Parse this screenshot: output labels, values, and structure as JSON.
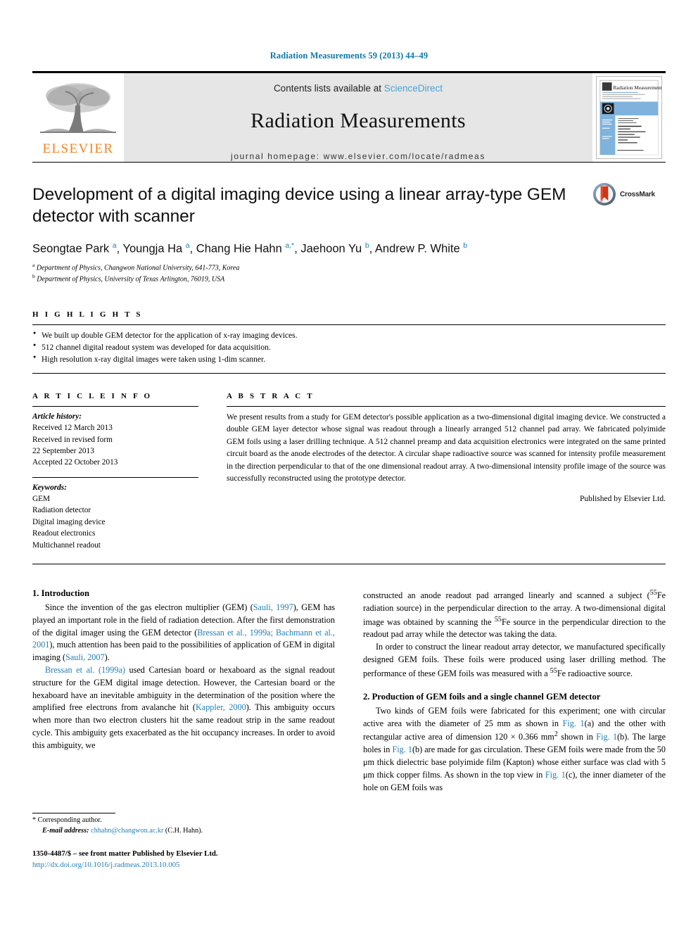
{
  "running_head": "Radiation Measurements 59 (2013) 44–49",
  "masthead": {
    "publisher_name": "ELSEVIER",
    "contents_prefix": "Contents lists available at ",
    "contents_link": "ScienceDirect",
    "journal_title": "Radiation Measurements",
    "homepage": "journal homepage: www.elsevier.com/locate/radmeas",
    "cover_title": "Radiation Measurements"
  },
  "article": {
    "title": "Development of a digital imaging device using a linear array-type GEM detector with scanner",
    "authors_html": "Seongtae Park <sup>a</sup>, Youngja Ha <sup>a</sup>, Chang Hie Hahn <sup>a,*</sup>, Jaehoon Yu <sup>b</sup>, Andrew P. White <sup>b</sup>",
    "affiliation_a": "Department of Physics, Changwon National University, 641-773, Korea",
    "affiliation_b": "Department of Physics, University of Texas Arlington, 76019, USA",
    "crossmark_label": "CrossMark"
  },
  "highlights": {
    "label": "H I G H L I G H T S",
    "items": [
      "We built up double GEM detector for the application of x-ray imaging devices.",
      "512 channel digital readout system was developed for data acquisition.",
      "High resolution x-ray digital images were taken using 1-dim scanner."
    ]
  },
  "article_info": {
    "label": "A R T I C L E   I N F O",
    "history_label": "Article history:",
    "history": [
      "Received 12 March 2013",
      "Received in revised form",
      "22 September 2013",
      "Accepted 22 October 2013"
    ],
    "keywords_label": "Keywords:",
    "keywords": [
      "GEM",
      "Radiation detector",
      "Digital imaging device",
      "Readout electronics",
      "Multichannel readout"
    ]
  },
  "abstract": {
    "label": "A B S T R A C T",
    "text": "We present results from a study for GEM detector's possible application as a two-dimensional digital imaging device. We constructed a double GEM layer detector whose signal was readout through a linearly arranged 512 channel pad array. We fabricated polyimide GEM foils using a laser drilling technique. A 512 channel preamp and data acquisition electronics were integrated on the same printed circuit board as the anode electrodes of the detector. A circular shape radioactive source was scanned for intensity profile measurement in the direction perpendicular to that of the one dimensional readout array. A two-dimensional intensity profile image of the source was successfully reconstructed using the prototype detector.",
    "publisher": "Published by Elsevier Ltd."
  },
  "body": {
    "section1_heading": "1. Introduction",
    "section1_p1_html": "Since the invention of the gas electron multiplier (GEM) (<a class=\"ref\" href=\"#\">Sauli, 1997</a>), GEM has played an important role in the field of radiation detection. After the first demonstration of the digital imager using the GEM detector (<a class=\"ref\" href=\"#\">Bressan et al., 1999a; Bachmann et al., 2001</a>), much attention has been paid to the possibilities of application of GEM in digital imaging (<a class=\"ref\" href=\"#\">Sauli, 2007</a>).",
    "section1_p2_html": "<a class=\"ref\" href=\"#\">Bressan et al. (1999a)</a> used Cartesian board or hexaboard as the signal readout structure for the GEM digital image detection. However, the Cartesian board or the hexaboard have an inevitable ambiguity in the determination of the position where the amplified free electrons from avalanche hit (<a class=\"ref\" href=\"#\">Kappler, 2000</a>). This ambiguity occurs when more than two electron clusters hit the same readout strip in the same readout cycle. This ambiguity gets exacerbated as the hit occupancy increases. In order to avoid this ambiguity, we",
    "section1_p2_cont_html": "constructed an anode readout pad arranged linearly and scanned a subject (<sup>55</sup>Fe radiation source) in the perpendicular direction to the array. A two-dimensional digital image was obtained by scanning the <sup>55</sup>Fe source in the perpendicular direction to the readout pad array while the detector was taking the data.",
    "section1_p3_html": "In order to construct the linear readout array detector, we manufactured specifically designed GEM foils. These foils were produced using laser drilling method. The performance of these GEM foils was measured with a <sup>55</sup>Fe radioactive source.",
    "section2_heading": "2. Production of GEM foils and a single channel GEM detector",
    "section2_p1_html": "Two kinds of GEM foils were fabricated for this experiment; one with circular active area with the diameter of 25 mm as shown in <a class=\"ref\" href=\"#\">Fig. 1</a>(a) and the other with rectangular active area of dimension 120 &times; 0.366 mm<sup>2</sup> shown in <a class=\"ref\" href=\"#\">Fig. 1</a>(b). The large holes in <a class=\"ref\" href=\"#\">Fig. 1</a>(b) are made for gas circulation. These GEM foils were made from the 50 &mu;m thick dielectric base polyimide film (Kapton) whose either surface was clad with 5 &mu;m thick copper films. As shown in the top view in <a class=\"ref\" href=\"#\">Fig. 1</a>(c), the inner diameter of the hole on GEM foils was"
  },
  "footer": {
    "corresponding_author": "* Corresponding author.",
    "email_label": "E-mail address:",
    "email": "chhahn@changwon.ac.kr",
    "email_suffix": " (C.H. Hahn).",
    "issn_line": "1350-4487/$ – see front matter Published by Elsevier Ltd.",
    "doi": "http://dx.doi.org/10.1016/j.radmeas.2013.10.005"
  },
  "colors": {
    "link": "#1f7fb5",
    "elsevier_orange": "#F5821F",
    "masthead_bg": "#e6e6e6",
    "running_head": "#0b7aa8"
  }
}
